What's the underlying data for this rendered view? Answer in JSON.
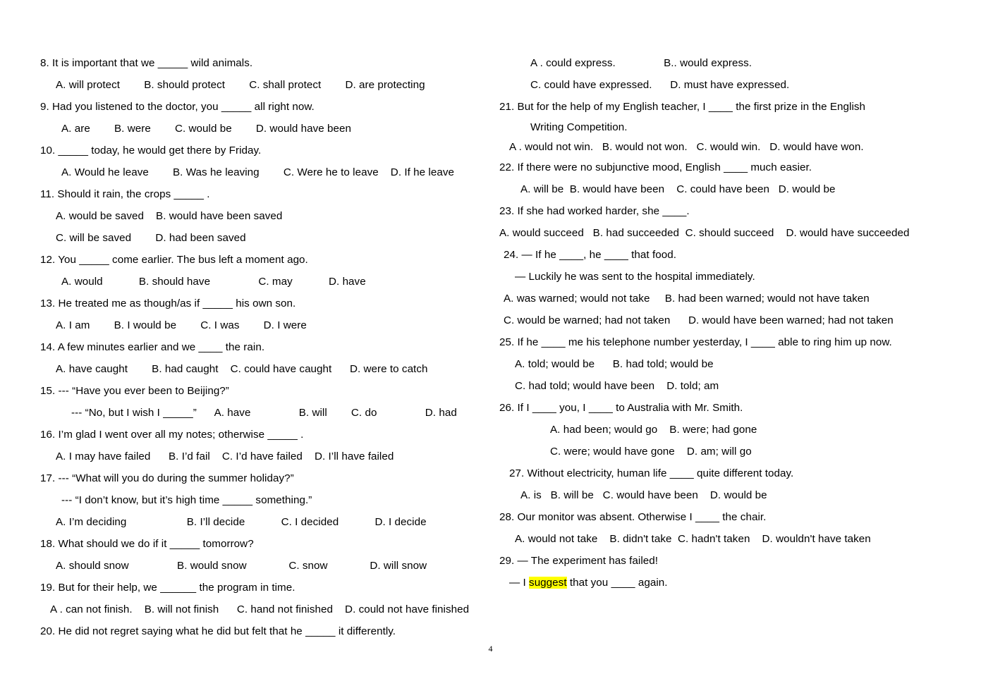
{
  "document": {
    "page_number": "4",
    "highlight_color": "#FFFF00",
    "text_color": "#000000",
    "background_color": "#FFFFFF"
  },
  "left_column": {
    "lines": [
      {
        "text": "8. It is important that we _____ wild animals.",
        "indent": "ind-0"
      },
      {
        "text": "A. will protect        B. should protect        C. shall protect        D. are protecting",
        "indent": "ind-m"
      },
      {
        "text": "9. Had you listened to the doctor, you _____ all right now.",
        "indent": "ind-0"
      },
      {
        "text": "A. are        B. were        C. would be        D. would have been",
        "indent": "ind-l"
      },
      {
        "text": "10. _____ today, he would get there by Friday.",
        "indent": "ind-0"
      },
      {
        "text": "A. Would he leave        B. Was he leaving        C. Were he to leave    D. If he leave",
        "indent": "ind-l"
      },
      {
        "text": "11. Should it rain, the crops _____ .",
        "indent": "ind-0"
      },
      {
        "text": "A. would be saved    B. would have been saved",
        "indent": "ind-m"
      },
      {
        "text": "C. will be saved        D. had been saved",
        "indent": "ind-m"
      },
      {
        "text": "12. You _____ come earlier. The bus left a moment ago.",
        "indent": "ind-0"
      },
      {
        "text": "A. would            B. should have                C. may            D. have",
        "indent": "ind-l"
      },
      {
        "text": "13. He treated me as though/as if _____ his own son.",
        "indent": "ind-0"
      },
      {
        "text": "A. I am        B. I would be        C. I was        D. I were",
        "indent": "ind-m"
      },
      {
        "text": "14. A few minutes earlier and we ____ the rain.",
        "indent": "ind-0"
      },
      {
        "text": "A. have caught        B. had caught    C. could have caught      D. were to catch",
        "indent": "ind-m"
      },
      {
        "text": "15. --- “Have you ever been to Beijing?”",
        "indent": "ind-0"
      },
      {
        "text": "--- “No, but I wish I _____”      A. have                B. will        C. do                D. had",
        "indent": "ind-xl"
      },
      {
        "text": "16. I’m glad I went over all my notes; otherwise _____ .",
        "indent": "ind-0"
      },
      {
        "text": "A. I may have failed      B. I’d fail    C. I’d have failed    D. I’ll have failed",
        "indent": "ind-m"
      },
      {
        "text": "17. --- “What will you do during the summer holiday?”",
        "indent": "ind-0"
      },
      {
        "text": "--- “I don’t know, but it’s high time _____ something.”",
        "indent": "ind-l"
      },
      {
        "text": "A. I’m deciding                    B. I’ll decide            C. I decided            D. I decide",
        "indent": "ind-m"
      },
      {
        "text": "18. What should we do if it _____ tomorrow?",
        "indent": "ind-0"
      },
      {
        "text": "A. should snow                B. would snow              C. snow              D. will snow",
        "indent": "ind-m"
      },
      {
        "text": "19. But for their help, we ______ the program in time.",
        "indent": "ind-0"
      },
      {
        "text": "A . can not finish.    B. will not finish      C. hand not finished    D. could not have finished",
        "indent": "ind-s"
      },
      {
        "text": "20. He did not regret saying what he did but felt that he _____ it differently.",
        "indent": "ind-0"
      }
    ]
  },
  "right_column": {
    "lines": [
      {
        "text": "A . could express.                B.. would express.",
        "indent": "ind-xl",
        "spacing": "normal"
      },
      {
        "text": "C. could have expressed.      D. must have expressed.",
        "indent": "ind-xl",
        "spacing": "normal"
      },
      {
        "text": "21. But for the help of my English teacher, I ____ the first prize in the English",
        "indent": "ind-0",
        "spacing": "normal"
      },
      {
        "text": "Writing Competition.",
        "indent": "ind-xl",
        "spacing": "tight-top"
      },
      {
        "text": "A . would not win.   B. would not won.   C. would win.   D. would have won.",
        "indent": "ind-s",
        "spacing": "tight"
      },
      {
        "text": "22. If there were no subjunctive mood, English ____ much easier.",
        "indent": "ind-0",
        "spacing": "normal"
      },
      {
        "text": "A. will be  B. would have been    C. could have been   D. would be",
        "indent": "ind-l",
        "spacing": "normal"
      },
      {
        "text": "23. If she had worked harder, she ____.",
        "indent": "ind-0",
        "spacing": "normal"
      },
      {
        "text": "A. would succeed   B. had succeeded  C. should succeed    D. would have succeeded",
        "indent": "ind-0",
        "spacing": "normal"
      },
      {
        "text": "24. — If he ____, he ____ that food.",
        "indent": "ind-xs",
        "spacing": "normal"
      },
      {
        "text": "— Luckily he was sent to the hospital immediately.",
        "indent": "ind-m",
        "spacing": "normal"
      },
      {
        "text": "A. was warned; would not take     B. had been warned; would not have taken",
        "indent": "ind-xs",
        "spacing": "normal"
      },
      {
        "text": "C. would be warned; had not taken      D. would have been warned; had not taken",
        "indent": "ind-xs",
        "spacing": "normal"
      },
      {
        "text": "25. If he ____ me his telephone number yesterday, I ____ able to ring him up now.",
        "indent": "ind-0",
        "spacing": "normal"
      },
      {
        "text": "A. told; would be      B. had told; would be",
        "indent": "ind-m",
        "spacing": "normal"
      },
      {
        "text": "C. had told; would have been    D. told; am",
        "indent": "ind-m",
        "spacing": "normal"
      },
      {
        "text": "26. If I ____ you, I ____ to Australia with Mr. Smith.",
        "indent": "ind-0",
        "spacing": "normal"
      },
      {
        "text": "A. had been; would go    B. were; had gone",
        "indent": "ind-xxl",
        "spacing": "normal"
      },
      {
        "text": "C. were; would have gone    D. am; will go",
        "indent": "ind-xxl",
        "spacing": "normal"
      },
      {
        "text": "27. Without electricity, human life ____ quite different today.",
        "indent": "ind-s",
        "spacing": "normal"
      },
      {
        "text": "A. is   B. will be   C. would have been    D. would be",
        "indent": "ind-l",
        "spacing": "normal"
      },
      {
        "text": "28. Our monitor was absent. Otherwise I ____ the chair.",
        "indent": "ind-0",
        "spacing": "normal"
      },
      {
        "text": "A. would not take    B. didn't take  C. hadn't taken    D. wouldn't have taken",
        "indent": "ind-m",
        "spacing": "normal"
      },
      {
        "text": "29. — The experiment has failed!",
        "indent": "ind-0",
        "spacing": "normal"
      }
    ],
    "last_line": {
      "indent": "ind-s",
      "prefix": "— I ",
      "highlighted": "suggest",
      "suffix": " that you ____ again."
    }
  }
}
